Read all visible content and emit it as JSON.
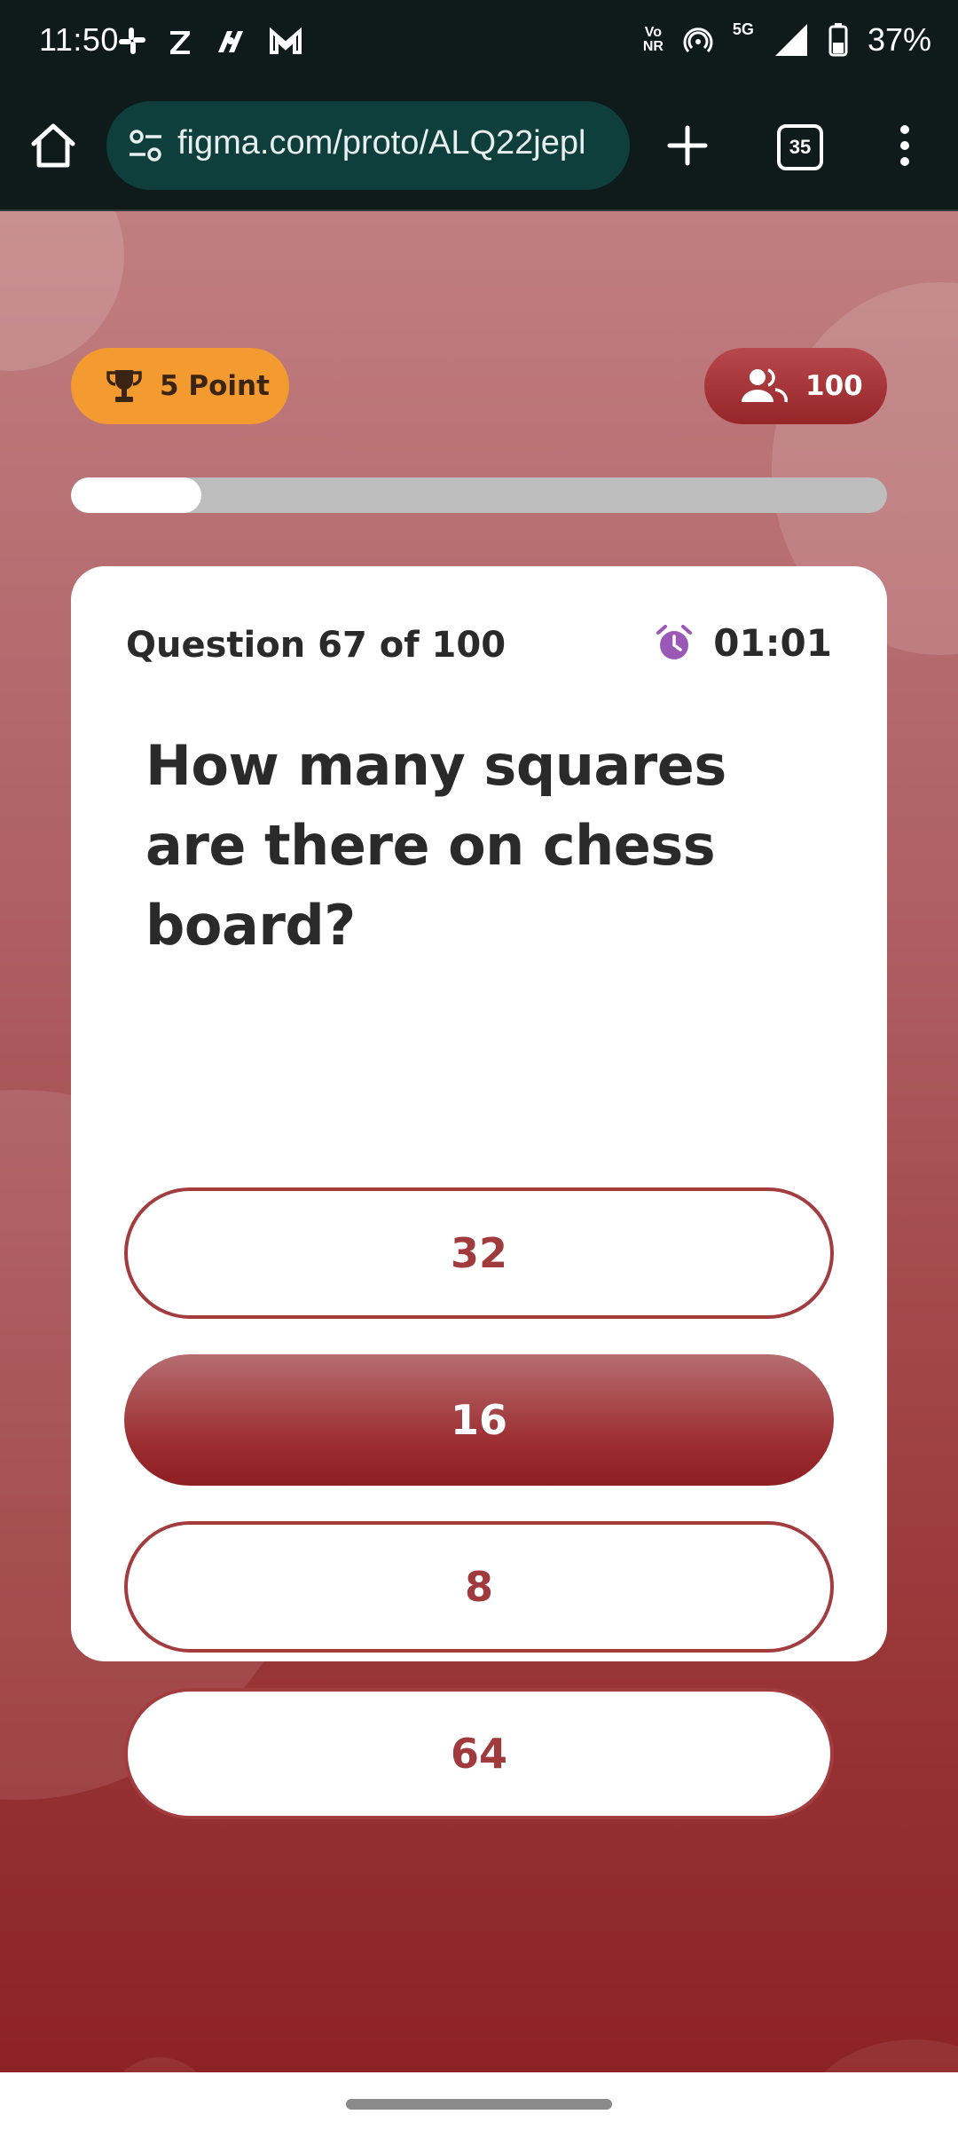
{
  "status_bar": {
    "time": "11:50",
    "app_icons": [
      "slack-icon",
      "zomato-icon",
      "paytm-icon",
      "gmail-icon"
    ],
    "volte_line1": "Vo",
    "volte_line2": "NR",
    "network": "5G",
    "battery": "37%"
  },
  "browser": {
    "url": "figma.com/proto/ALQ22jepl",
    "tab_count": "35"
  },
  "quiz": {
    "points_label": "5 Point",
    "players_count": "100",
    "progress": 0.16,
    "question_counter": "Question 67 of 100",
    "timer": "01:01",
    "question": "How many squares are there on chess board?",
    "options": [
      {
        "label": "32",
        "selected": false
      },
      {
        "label": "16",
        "selected": true
      },
      {
        "label": "8",
        "selected": false
      },
      {
        "label": "64",
        "selected": false
      }
    ]
  },
  "colors": {
    "accent_red": "#9b2b2e",
    "points_orange": "#f39a30",
    "timer_purple": "#9b59b6"
  }
}
